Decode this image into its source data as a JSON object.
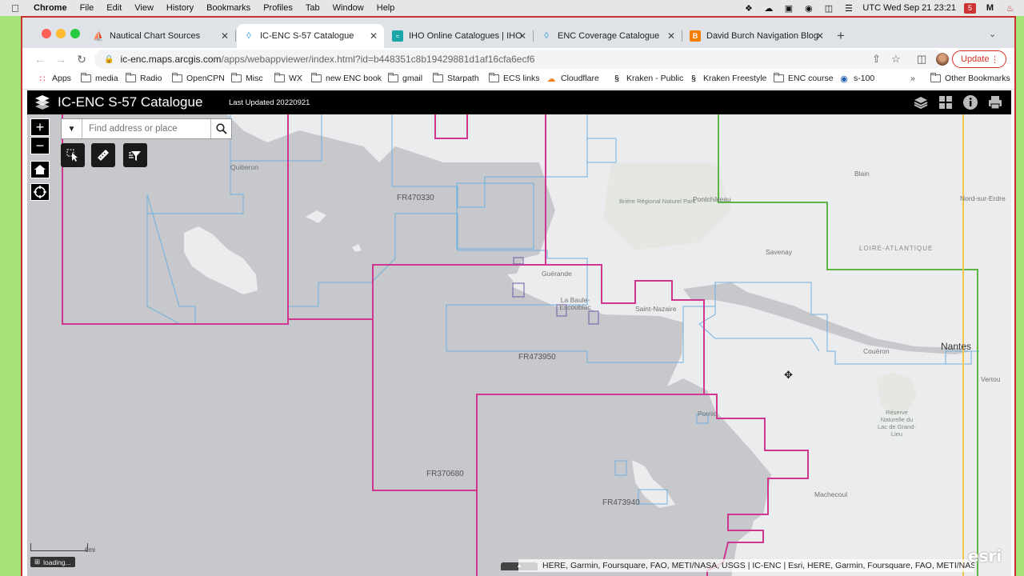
{
  "macos_menu": {
    "app": "Chrome",
    "items": [
      "File",
      "Edit",
      "View",
      "History",
      "Bookmarks",
      "Profiles",
      "Tab",
      "Window",
      "Help"
    ],
    "clock": "UTC Wed Sep 21 23:21"
  },
  "browser": {
    "tabs": [
      {
        "label": "Nautical Chart Sources",
        "icon": "sailboat-icon",
        "active": false
      },
      {
        "label": "IC-ENC S-57 Catalogue",
        "icon": "arcgis-icon",
        "active": true
      },
      {
        "label": "IHO Online Catalogues | IHO",
        "icon": "iho-icon",
        "active": false
      },
      {
        "label": "ENC Coverage Catalogue",
        "icon": "arcgis-icon",
        "active": false
      },
      {
        "label": "David Burch Navigation Blog",
        "icon": "blogger-icon",
        "active": false
      }
    ],
    "url_host": "ic-enc.maps.arcgis.com",
    "url_path": "/apps/webappviewer/index.html?id=b448351c8b19429881d1af16cfa6ecf6",
    "update_label": "Update",
    "bookmarks": [
      {
        "label": "Apps",
        "icon": "apps-grid-icon"
      },
      {
        "label": "media",
        "icon": "folder-icon"
      },
      {
        "label": "Radio",
        "icon": "folder-icon"
      },
      {
        "label": "OpenCPN",
        "icon": "folder-icon"
      },
      {
        "label": "Misc",
        "icon": "folder-icon"
      },
      {
        "label": "WX",
        "icon": "folder-icon"
      },
      {
        "label": "new ENC book",
        "icon": "folder-icon"
      },
      {
        "label": "gmail",
        "icon": "folder-icon"
      },
      {
        "label": "Starpath",
        "icon": "folder-icon"
      },
      {
        "label": "ECS links",
        "icon": "folder-icon"
      },
      {
        "label": "Cloudflare",
        "icon": "cloudflare-icon"
      },
      {
        "label": "Kraken - Public",
        "icon": "kraken-icon"
      },
      {
        "label": "Kraken Freestyle",
        "icon": "kraken-icon"
      },
      {
        "label": "ENC course",
        "icon": "folder-icon"
      },
      {
        "label": "s-100",
        "icon": "noaa-icon"
      }
    ],
    "other_bookmarks": "Other Bookmarks"
  },
  "app": {
    "title": "IC-ENC S-57 Catalogue",
    "last_updated": "Last Updated 20220921",
    "header_icons": [
      "layers-icon",
      "grid-icon",
      "info-icon",
      "print-icon"
    ]
  },
  "map": {
    "search_placeholder": "Find address or place",
    "chart_labels": [
      "FR470330",
      "FR473950",
      "FR370680",
      "FR473940"
    ],
    "places": [
      "Quiberon",
      "Blain",
      "Pontchâteau",
      "Nord-sur-Erdre",
      "Brière Régional Naturel Park",
      "Savenay",
      "LOIRE-ATLANTIQUE",
      "Guérande",
      "La Baule-Escoublac",
      "Saint-Nazaire",
      "Nantes",
      "Couëron",
      "Vertou",
      "Pornic",
      "Réserve Naturelle du Lac de Grand-Lieu",
      "Machecoul"
    ],
    "scale_label": "6mi",
    "loading": "loading...",
    "attribution": "HERE, Garmin, Foursquare, FAO, METI/NASA, USGS | IC-ENC | Esri, HERE, Garmin, Foursquare, FAO, METI/NASA...",
    "esri_label": "esri",
    "colors": {
      "sea": "#c6c8cb",
      "land": "#ebeced",
      "band3": "#d0368f",
      "band4": "#6fb1df",
      "band2": "#5fb544",
      "band1": "#f2c64b"
    }
  }
}
